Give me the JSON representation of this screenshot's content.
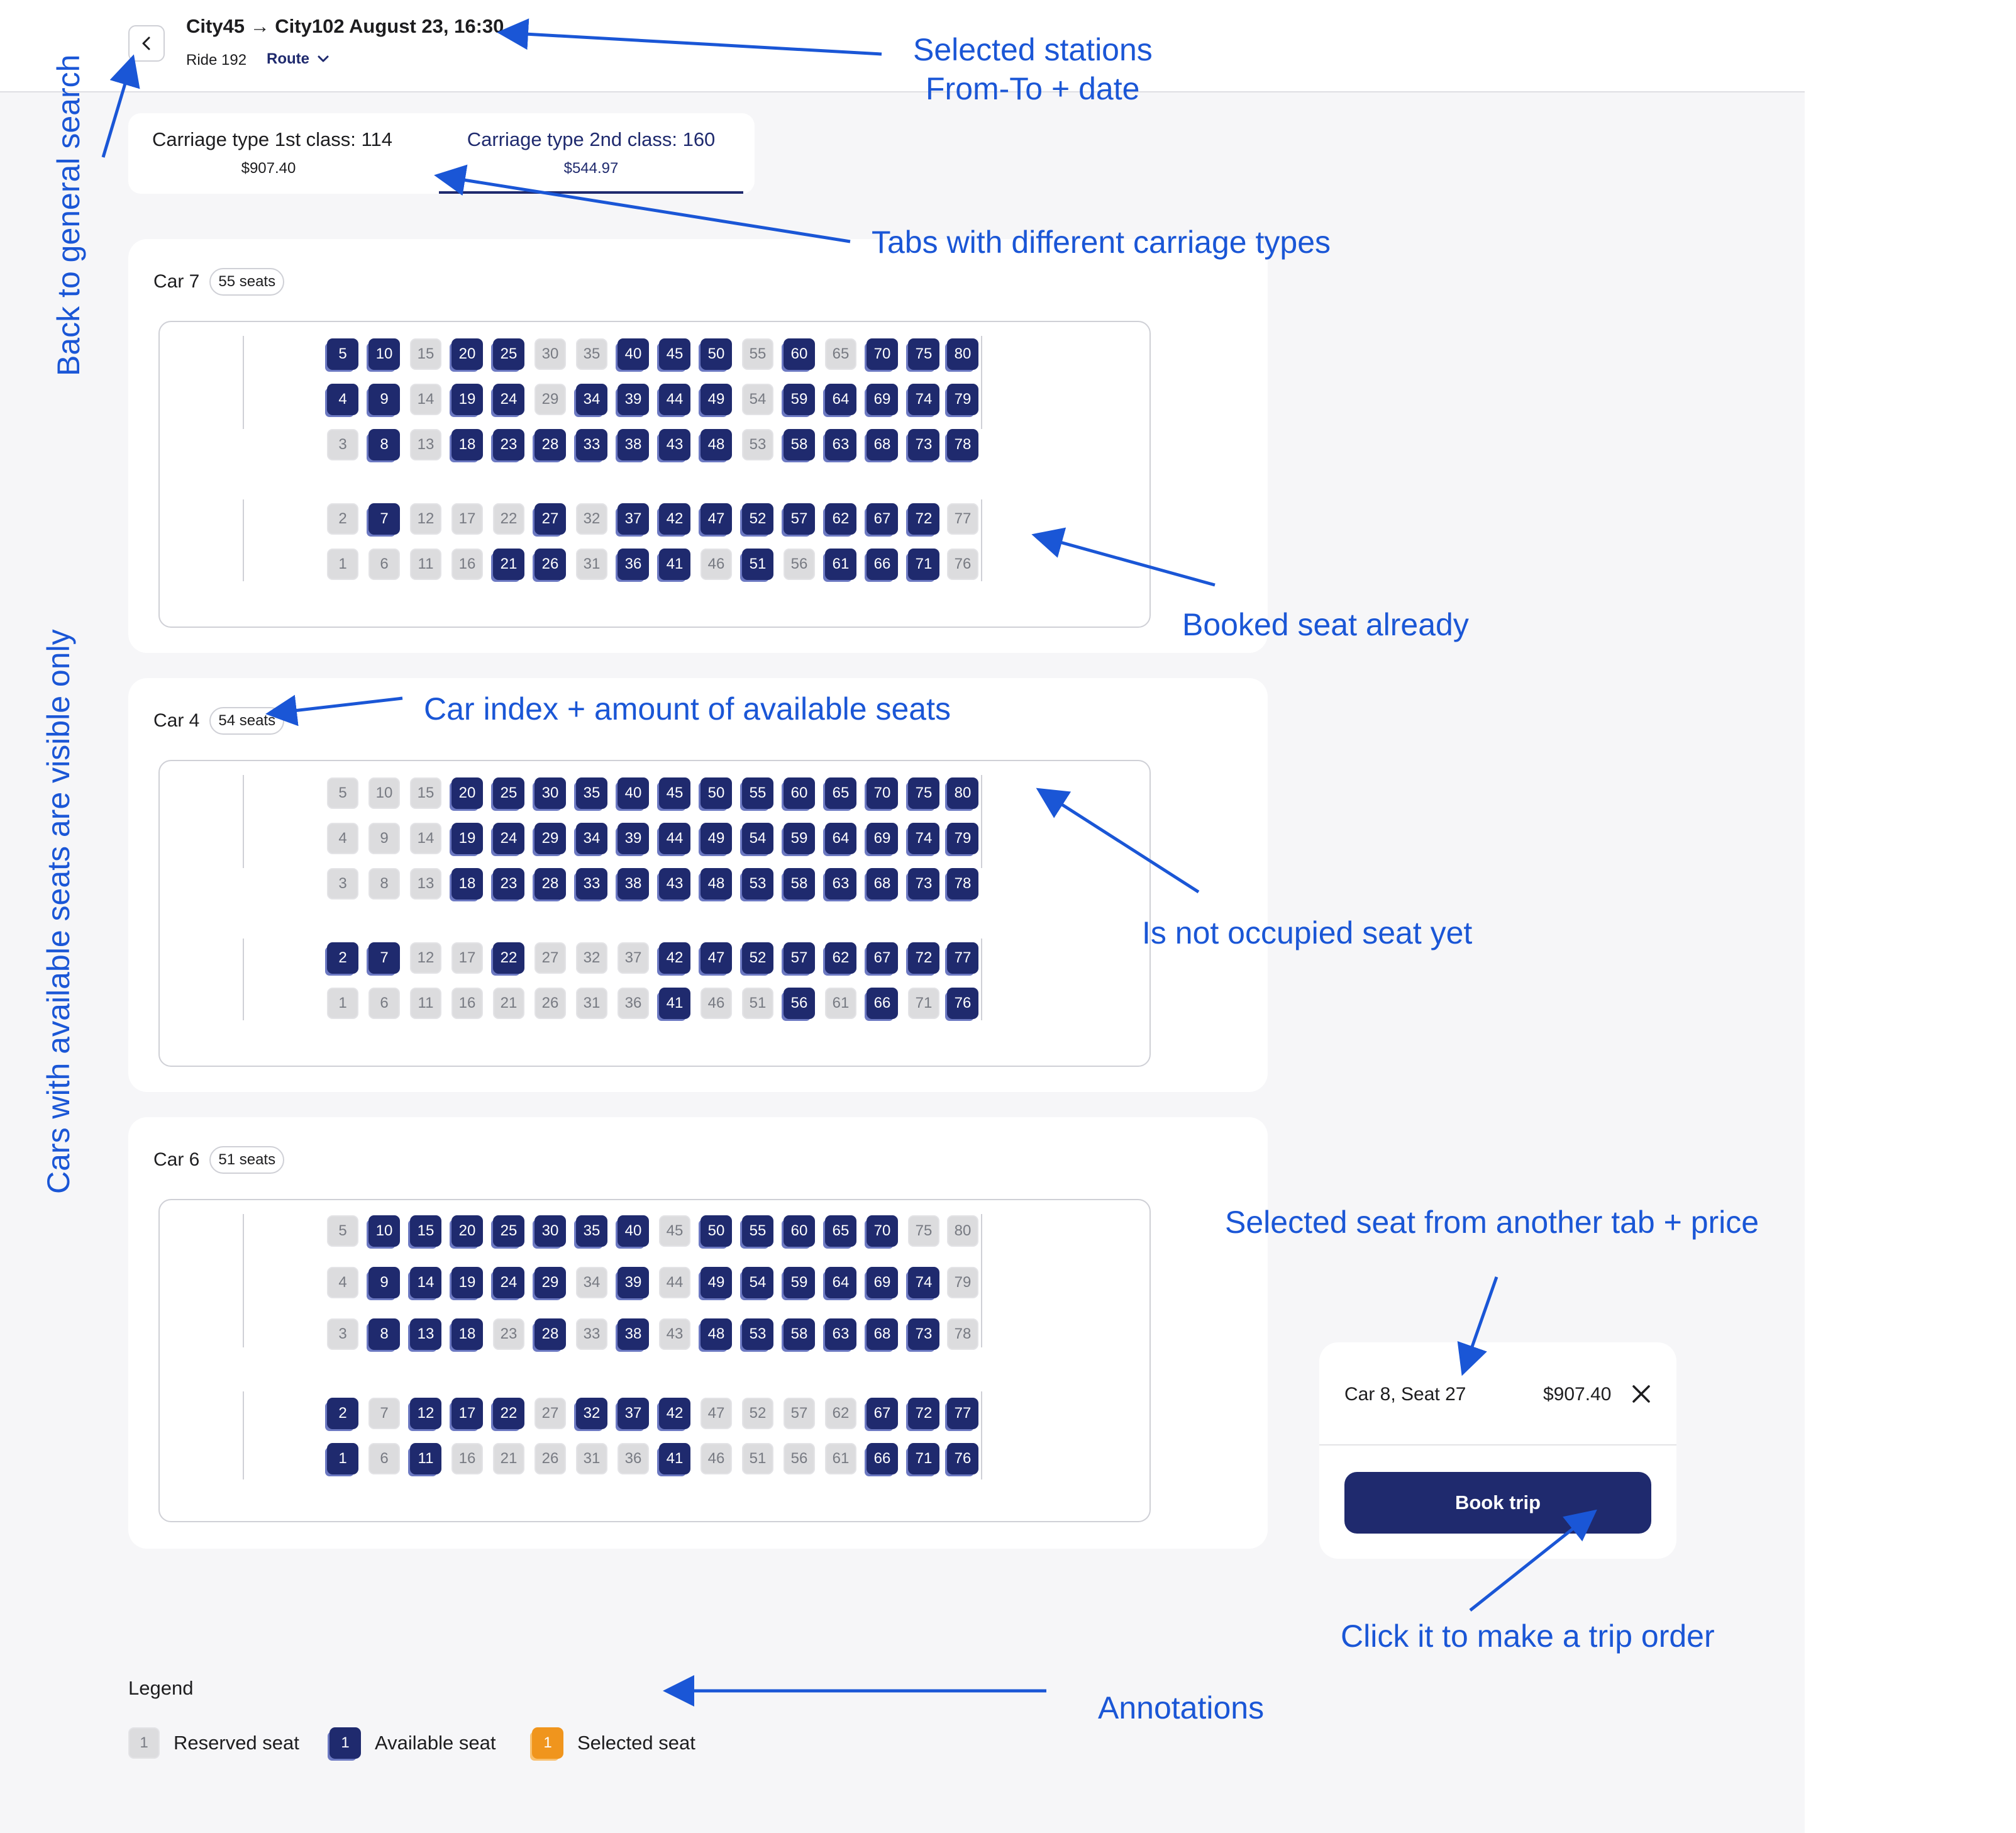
{
  "header": {
    "route_title": "City45 → City102 August 23, 16:30",
    "ride_label": "Ride 192",
    "route_link": "Route",
    "back_icon": "chevron-left-icon"
  },
  "tabs": [
    {
      "label": "Carriage type 1st class: 114",
      "price": "$907.40",
      "active": false
    },
    {
      "label": "Carriage type 2nd class: 160",
      "price": "$544.97",
      "active": true
    }
  ],
  "cars": [
    {
      "label": "Car 7",
      "badge": "55 seats",
      "reserved": [
        3,
        15,
        30,
        35,
        55,
        65,
        14,
        29,
        54,
        13,
        53,
        1,
        2,
        6,
        11,
        12,
        16,
        17,
        22,
        31,
        32,
        46,
        56,
        76,
        77
      ]
    },
    {
      "label": "Car 4",
      "badge": "54 seats",
      "reserved": [
        5,
        10,
        15,
        4,
        9,
        14,
        3,
        8,
        13,
        12,
        17,
        27,
        32,
        37,
        1,
        6,
        11,
        16,
        21,
        26,
        31,
        36,
        46,
        51,
        61,
        71
      ]
    },
    {
      "label": "Car 6",
      "badge": "51 seats",
      "reserved": [
        5,
        45,
        75,
        80,
        4,
        34,
        44,
        79,
        3,
        23,
        33,
        43,
        78,
        7,
        27,
        47,
        52,
        57,
        62,
        6,
        16,
        21,
        26,
        31,
        36,
        46,
        51,
        56,
        61
      ]
    }
  ],
  "summary": {
    "seat": "Car 8, Seat 27",
    "price": "$907.40",
    "close_icon": "close-icon",
    "book_label": "Book trip"
  },
  "legend": {
    "title": "Legend",
    "items": [
      {
        "num": "1",
        "label": "Reserved seat",
        "type": "reserved"
      },
      {
        "num": "1",
        "label": "Available seat",
        "type": "available"
      },
      {
        "num": "1",
        "label": "Selected seat",
        "type": "selected"
      }
    ]
  },
  "colors": {
    "available": "#1f2a6e",
    "reserved": "#dcdcde",
    "selected": "#f0951d",
    "annotation": "#1a56d6"
  },
  "annotations": {
    "selected_stations_1": "Selected stations",
    "selected_stations_2": "From-To + date",
    "tabs": "Tabs with different carriage types",
    "back": "Back to general search",
    "booked": "Booked seat already",
    "car_index": "Car index + amount of available seats",
    "not_occupied": "Is not occupied seat yet",
    "cars_visible": "Cars with available seats are visible only",
    "selected_seat": "Selected seat from another tab + price",
    "click_book": "Click it to make a trip order",
    "legend": "Annotations"
  }
}
